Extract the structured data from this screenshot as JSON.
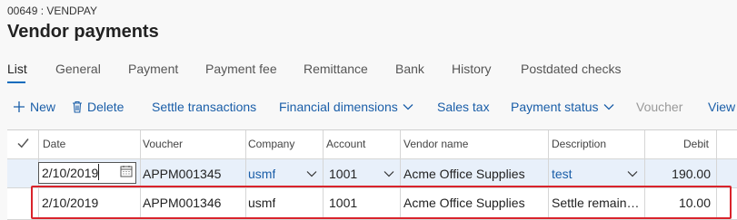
{
  "header": {
    "breadcrumb": "00649 : VENDPAY",
    "title": "Vendor payments"
  },
  "tabs": [
    {
      "label": "List"
    },
    {
      "label": "General"
    },
    {
      "label": "Payment"
    },
    {
      "label": "Payment fee"
    },
    {
      "label": "Remittance"
    },
    {
      "label": "Bank"
    },
    {
      "label": "History"
    },
    {
      "label": "Postdated checks"
    }
  ],
  "actions": {
    "new": "New",
    "delete": "Delete",
    "settle": "Settle transactions",
    "financial_dimensions": "Financial dimensions",
    "sales_tax": "Sales tax",
    "payment_status": "Payment status",
    "voucher": "Voucher",
    "view": "View"
  },
  "grid": {
    "columns": [
      "Date",
      "Voucher",
      "Company",
      "Account",
      "Vendor name",
      "Description",
      "Debit"
    ],
    "rows": [
      {
        "date": "2/10/2019",
        "voucher": "APPM001345",
        "company": "usmf",
        "account": "1001",
        "vendor": "Acme Office Supplies",
        "description": "test",
        "debit": "190.00"
      },
      {
        "date": "2/10/2019",
        "voucher": "APPM001346",
        "company": "usmf",
        "account": "1001",
        "vendor": "Acme Office Supplies",
        "description": "Settle remain…",
        "debit": "10.00"
      }
    ]
  },
  "colors": {
    "accent": "#0f6cbd",
    "link": "#1a5ea8",
    "highlight": "#d9232b",
    "selected_row": "#e8f0fa"
  }
}
